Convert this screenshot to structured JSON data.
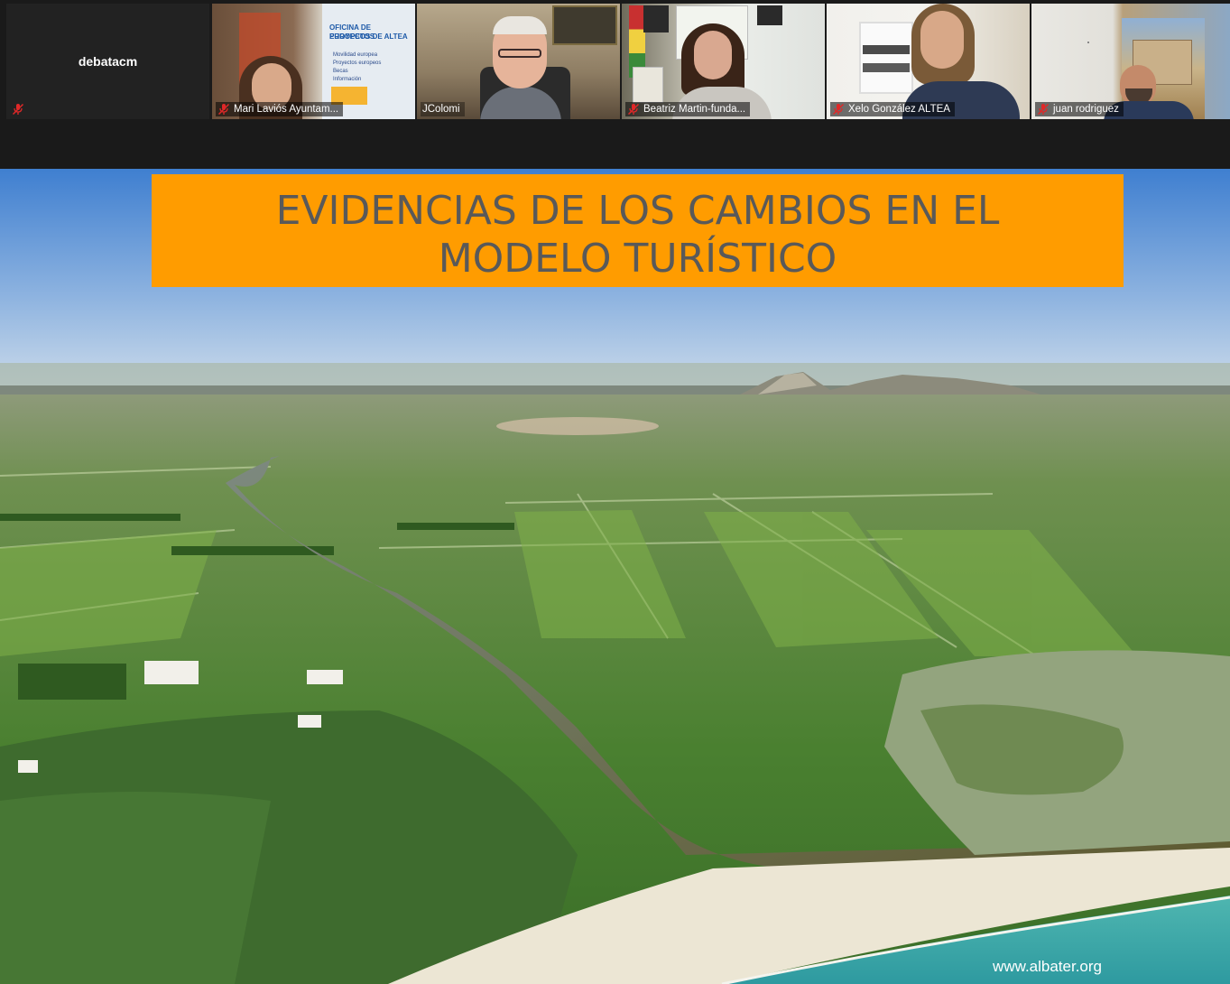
{
  "participants": [
    {
      "name": "debatacm",
      "video": false,
      "muted": true
    },
    {
      "name": "Mari Laviós Ayuntam...",
      "video": true,
      "muted": true
    },
    {
      "name": "JColomi",
      "video": true,
      "muted": false,
      "speaking": true
    },
    {
      "name": "Beatriz Martin-funda...",
      "video": true,
      "muted": true
    },
    {
      "name": "Xelo González ALTEA",
      "video": true,
      "muted": true
    },
    {
      "name": "juan rodriguez",
      "video": true,
      "muted": true
    }
  ],
  "poster_text": {
    "line1": "OFICINA DE PROYECTOS",
    "line2": "EUROPEOS DE ALTEA",
    "items": [
      "Movilidad europea",
      "Proyectos europeos",
      "Becas",
      "Información"
    ]
  },
  "slide": {
    "title_line1": "EVIDENCIAS DE LOS CAMBIOS EN EL",
    "title_line2": "MODELO TURÍSTICO",
    "credit": "www.albater.org"
  },
  "colors": {
    "title_bg": "#ff9c00",
    "title_text": "#595959",
    "active_speaker": "#3db33d",
    "mic_off": "#e02828"
  }
}
